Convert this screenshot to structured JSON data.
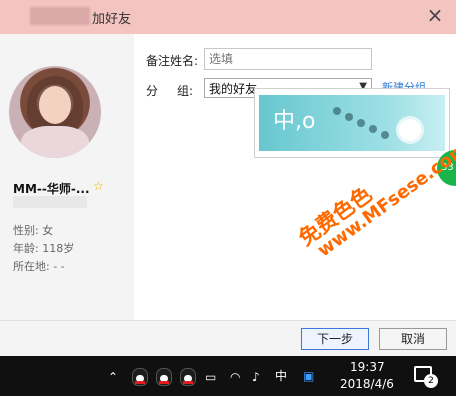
{
  "window": {
    "title": "加好友"
  },
  "profile": {
    "name": "MM--华师-...",
    "info": [
      "性别: 女",
      "年龄: 118岁",
      "所在地: -  -"
    ]
  },
  "form": {
    "remark_label": "备注姓名:",
    "remark_placeholder": "选填",
    "group_label": "分",
    "group_label2": "组:",
    "group_value": "我的好友",
    "new_group_link": "新建分组"
  },
  "popup": {
    "banner_text": "中,o",
    "badge_text": "33"
  },
  "buttons": {
    "next": "下一步",
    "cancel": "取消"
  },
  "taskbar": {
    "time": "19:37",
    "date": "2018/4/6",
    "input_method": "中",
    "notification_count": "2"
  },
  "watermark": {
    "line1": "免费色色",
    "line2": "www.MFsese.com"
  }
}
